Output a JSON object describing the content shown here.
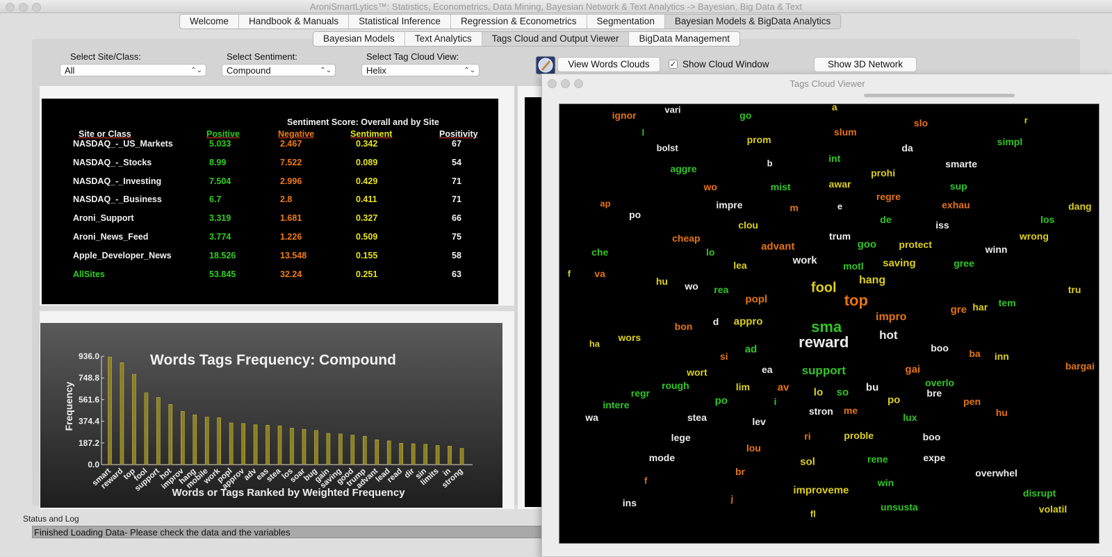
{
  "window": {
    "title": "AroniSmartLytics™: Statistics, Econometrics, Data Mining, Bayesian Network & Text Analytics -> Bayesian, Big Data & Text"
  },
  "main_tabs": [
    "Welcome",
    "Handbook & Manuals",
    "Statistical Inference",
    "Regression & Econometrics",
    "Segmentation",
    "Bayesian Models & BigData Analytics"
  ],
  "sub_tabs": [
    "Bayesian Models",
    "Text Analytics",
    "Tags Cloud and Output Viewer",
    "BigData Management"
  ],
  "controls": {
    "site_label": "Select Site/Class:",
    "site_value": "All",
    "sentiment_label": "Select  Sentiment:",
    "sentiment_value": "Compound",
    "view_label": "Select Tag Cloud View:",
    "view_value": "Helix",
    "view_clouds_button": "View Words Clouds",
    "show_cloud_label": "Show Cloud Window",
    "show_cloud_checked": true,
    "show_3d_button": "Show 3D Network"
  },
  "sentiment_table": {
    "title": "Sentiment Score: Overall and by Site",
    "headers": [
      "Site or Class",
      "Positive",
      "Negative",
      "Sentiment",
      "Positivity"
    ],
    "rows": [
      [
        "NASDAQ_-_US_Markets",
        "5.033",
        "2.467",
        "0.342",
        "67"
      ],
      [
        "NASDAQ_-_Stocks",
        "8.99",
        "7.522",
        "0.089",
        "54"
      ],
      [
        "NASDAQ_-_Investing",
        "7.504",
        "2.996",
        "0.429",
        "71"
      ],
      [
        "NASDAQ_-_Business",
        "6.7",
        "2.8",
        "0.411",
        "71"
      ],
      [
        "Aroni_Support",
        "3.319",
        "1.681",
        "0.327",
        "66"
      ],
      [
        "Aroni_News_Feed",
        "3.774",
        "1.226",
        "0.509",
        "75"
      ],
      [
        "Apple_Developer_News",
        "18.526",
        "13.548",
        "0.155",
        "58"
      ],
      [
        "AllSites",
        "53.845",
        "32.24",
        "0.251",
        "63"
      ]
    ]
  },
  "chart_data": {
    "type": "bar",
    "title": "Words Tags Frequency: Compound",
    "xlabel": "Words or Tags Ranked by Weighted Frequency",
    "ylabel": "Frequency",
    "ylim": [
      0,
      936.0
    ],
    "yticks": [
      "936.0",
      "748.8",
      "561.6",
      "374.4",
      "187.2",
      "0.0"
    ],
    "grid": false,
    "categories": [
      "smart",
      "reward",
      "top",
      "fool",
      "support",
      "hot",
      "improv",
      "hang",
      "mobile",
      "work",
      "popl",
      "approv",
      "adv",
      "eas",
      "stea",
      "los",
      "soar",
      "bug",
      "gain",
      "saving",
      "good",
      "trump",
      "advant",
      "lead",
      "read",
      "dir",
      "sin",
      "limits",
      "in",
      "strong"
    ],
    "values": [
      930,
      880,
      780,
      620,
      580,
      520,
      460,
      430,
      410,
      405,
      360,
      355,
      345,
      340,
      335,
      315,
      305,
      295,
      270,
      265,
      255,
      245,
      215,
      205,
      185,
      180,
      175,
      165,
      160,
      140
    ]
  },
  "cloud": {
    "title": "Tags Cloud Viewer",
    "words": [
      {
        "t": "ignor",
        "c": "o",
        "s": 14,
        "x": 12,
        "y": 2.6
      },
      {
        "t": "vari",
        "c": "w",
        "s": 13,
        "x": 21,
        "y": 1.2
      },
      {
        "t": "go",
        "c": "g",
        "s": 14,
        "x": 34.5,
        "y": 2.6
      },
      {
        "t": "a",
        "c": "y",
        "s": 14,
        "x": 51,
        "y": 0.6
      },
      {
        "t": "r",
        "c": "y",
        "s": 13,
        "x": 86.5,
        "y": 3.6
      },
      {
        "t": "slo",
        "c": "o",
        "s": 14,
        "x": 67,
        "y": 4.2
      },
      {
        "t": "l",
        "c": "g",
        "s": 13,
        "x": 15.5,
        "y": 6.5
      },
      {
        "t": "prom",
        "c": "y",
        "s": 14,
        "x": 37,
        "y": 8
      },
      {
        "t": "slum",
        "c": "o",
        "s": 14,
        "x": 53,
        "y": 6.4
      },
      {
        "t": "simpl",
        "c": "g",
        "s": 14,
        "x": 83.5,
        "y": 8.5
      },
      {
        "t": "bolst",
        "c": "w",
        "s": 13,
        "x": 20,
        "y": 10
      },
      {
        "t": "da",
        "c": "w",
        "s": 14,
        "x": 64.5,
        "y": 10
      },
      {
        "t": "int",
        "c": "g",
        "s": 14,
        "x": 51,
        "y": 12.4
      },
      {
        "t": "b",
        "c": "w",
        "s": 13,
        "x": 39,
        "y": 13.4
      },
      {
        "t": "smarte",
        "c": "w",
        "s": 14,
        "x": 74.5,
        "y": 13.6
      },
      {
        "t": "aggre",
        "c": "g",
        "s": 14,
        "x": 23,
        "y": 14.7
      },
      {
        "t": "prohi",
        "c": "y",
        "s": 14,
        "x": 60,
        "y": 15.7
      },
      {
        "t": "wo",
        "c": "o",
        "s": 14,
        "x": 28,
        "y": 18.8
      },
      {
        "t": "mist",
        "c": "g",
        "s": 14,
        "x": 41,
        "y": 18.8
      },
      {
        "t": "awar",
        "c": "y",
        "s": 14,
        "x": 52,
        "y": 18.2
      },
      {
        "t": "sup",
        "c": "g",
        "s": 14,
        "x": 74,
        "y": 18.6
      },
      {
        "t": "regre",
        "c": "o",
        "s": 14,
        "x": 61,
        "y": 21.1
      },
      {
        "t": "ap",
        "c": "o",
        "s": 13,
        "x": 8.5,
        "y": 22.6
      },
      {
        "t": "impre",
        "c": "w",
        "s": 14,
        "x": 31.5,
        "y": 23
      },
      {
        "t": "m",
        "c": "o",
        "s": 14,
        "x": 43.5,
        "y": 23.6
      },
      {
        "t": "e",
        "c": "w",
        "s": 13,
        "x": 52,
        "y": 23.3
      },
      {
        "t": "exhau",
        "c": "o",
        "s": 14,
        "x": 73.5,
        "y": 22.9
      },
      {
        "t": "dang",
        "c": "y",
        "s": 14,
        "x": 96.5,
        "y": 23.3
      },
      {
        "t": "po",
        "c": "w",
        "s": 14,
        "x": 14,
        "y": 25.1
      },
      {
        "t": "de",
        "c": "g",
        "s": 14,
        "x": 60.5,
        "y": 26.3
      },
      {
        "t": "clou",
        "c": "y",
        "s": 14,
        "x": 35,
        "y": 27.5
      },
      {
        "t": "iss",
        "c": "w",
        "s": 14,
        "x": 71,
        "y": 27.5
      },
      {
        "t": "los",
        "c": "g",
        "s": 14,
        "x": 90.5,
        "y": 26.3
      },
      {
        "t": "cheap",
        "c": "o",
        "s": 14,
        "x": 23.5,
        "y": 30.6
      },
      {
        "t": "trum",
        "c": "w",
        "s": 14,
        "x": 52,
        "y": 30
      },
      {
        "t": "wrong",
        "c": "y",
        "s": 14,
        "x": 88,
        "y": 30
      },
      {
        "t": "advant",
        "c": "o",
        "s": 15,
        "x": 40.5,
        "y": 32.5
      },
      {
        "t": "goo",
        "c": "g",
        "s": 15,
        "x": 57,
        "y": 31.9
      },
      {
        "t": "protect",
        "c": "y",
        "s": 14,
        "x": 66,
        "y": 31.9
      },
      {
        "t": "che",
        "c": "g",
        "s": 14,
        "x": 7.5,
        "y": 33.7
      },
      {
        "t": "lo",
        "c": "g",
        "s": 14,
        "x": 28,
        "y": 33.7
      },
      {
        "t": "winn",
        "c": "w",
        "s": 14,
        "x": 81,
        "y": 33.1
      },
      {
        "t": "work",
        "c": "w",
        "s": 15,
        "x": 45.5,
        "y": 35.6
      },
      {
        "t": "lea",
        "c": "y",
        "s": 14,
        "x": 33.5,
        "y": 36.7
      },
      {
        "t": "motl",
        "c": "g",
        "s": 14,
        "x": 54.5,
        "y": 36.9
      },
      {
        "t": "saving",
        "c": "y",
        "s": 15,
        "x": 63,
        "y": 36.3
      },
      {
        "t": "gree",
        "c": "g",
        "s": 14,
        "x": 75,
        "y": 36.3
      },
      {
        "t": "f",
        "c": "y",
        "s": 13,
        "x": 1.8,
        "y": 38.6
      },
      {
        "t": "va",
        "c": "o",
        "s": 14,
        "x": 7.5,
        "y": 38.6
      },
      {
        "t": "hu",
        "c": "y",
        "s": 14,
        "x": 19,
        "y": 40.4
      },
      {
        "t": "wo",
        "c": "w",
        "s": 14,
        "x": 24.5,
        "y": 41.5
      },
      {
        "t": "fool",
        "c": "y",
        "s": 20,
        "x": 49,
        "y": 41.9
      },
      {
        "t": "hang",
        "c": "y",
        "s": 16,
        "x": 58,
        "y": 40.2
      },
      {
        "t": "tru",
        "c": "y",
        "s": 14,
        "x": 95.5,
        "y": 42.3
      },
      {
        "t": "rea",
        "c": "g",
        "s": 14,
        "x": 30,
        "y": 42.3
      },
      {
        "t": "popl",
        "c": "o",
        "s": 15,
        "x": 36.5,
        "y": 44.5
      },
      {
        "t": "top",
        "c": "o",
        "s": 22,
        "x": 55,
        "y": 44.8
      },
      {
        "t": "tem",
        "c": "g",
        "s": 14,
        "x": 83,
        "y": 45.2
      },
      {
        "t": "gre",
        "c": "o",
        "s": 15,
        "x": 74,
        "y": 46.9
      },
      {
        "t": "har",
        "c": "y",
        "s": 14,
        "x": 78,
        "y": 46.2
      },
      {
        "t": "impro",
        "c": "o",
        "s": 16,
        "x": 61.5,
        "y": 48.5
      },
      {
        "t": "sma",
        "c": "g",
        "s": 22,
        "x": 49.5,
        "y": 50.8
      },
      {
        "t": "bon",
        "c": "o",
        "s": 14,
        "x": 23,
        "y": 50.6
      },
      {
        "t": "d",
        "c": "w",
        "s": 14,
        "x": 29,
        "y": 49.6
      },
      {
        "t": "appro",
        "c": "y",
        "s": 15,
        "x": 35,
        "y": 49.6
      },
      {
        "t": "hot",
        "c": "w",
        "s": 17,
        "x": 61,
        "y": 52.7
      },
      {
        "t": "ha",
        "c": "y",
        "s": 13,
        "x": 6.5,
        "y": 54.6
      },
      {
        "t": "wors",
        "c": "y",
        "s": 14,
        "x": 13,
        "y": 53.2
      },
      {
        "t": "reward",
        "c": "w",
        "s": 22,
        "x": 49,
        "y": 54.3
      },
      {
        "t": "boo",
        "c": "w",
        "s": 14,
        "x": 70.5,
        "y": 55.5
      },
      {
        "t": "ad",
        "c": "g",
        "s": 15,
        "x": 35.5,
        "y": 55.8
      },
      {
        "t": "ba",
        "c": "o",
        "s": 14,
        "x": 77,
        "y": 56.8
      },
      {
        "t": "inn",
        "c": "y",
        "s": 14,
        "x": 82,
        "y": 57.5
      },
      {
        "t": "si",
        "c": "o",
        "s": 14,
        "x": 30.5,
        "y": 57.5
      },
      {
        "t": "bargai",
        "c": "o",
        "s": 14,
        "x": 96.5,
        "y": 59.7
      },
      {
        "t": "wort",
        "c": "y",
        "s": 14,
        "x": 25.5,
        "y": 61
      },
      {
        "t": "ea",
        "c": "w",
        "s": 14,
        "x": 38.5,
        "y": 60.4
      },
      {
        "t": "support",
        "c": "g",
        "s": 17,
        "x": 49,
        "y": 60.8
      },
      {
        "t": "gai",
        "c": "o",
        "s": 15,
        "x": 65.5,
        "y": 60.4
      },
      {
        "t": "rough",
        "c": "g",
        "s": 14,
        "x": 21.5,
        "y": 64.1
      },
      {
        "t": "lim",
        "c": "y",
        "s": 14,
        "x": 34,
        "y": 64.4
      },
      {
        "t": "av",
        "c": "o",
        "s": 15,
        "x": 41.5,
        "y": 64.6
      },
      {
        "t": "bu",
        "c": "w",
        "s": 15,
        "x": 58,
        "y": 64.6
      },
      {
        "t": "overlo",
        "c": "g",
        "s": 14,
        "x": 70.5,
        "y": 63.4
      },
      {
        "t": "regr",
        "c": "g",
        "s": 14,
        "x": 15,
        "y": 65.8
      },
      {
        "t": "lo",
        "c": "y",
        "s": 15,
        "x": 48,
        "y": 65.7
      },
      {
        "t": "so",
        "c": "g",
        "s": 15,
        "x": 52.5,
        "y": 65.7
      },
      {
        "t": "bre",
        "c": "w",
        "s": 14,
        "x": 69.5,
        "y": 65.8
      },
      {
        "t": "po",
        "c": "g",
        "s": 15,
        "x": 30,
        "y": 67.6
      },
      {
        "t": "i",
        "c": "g",
        "s": 14,
        "x": 40,
        "y": 67.8
      },
      {
        "t": "po",
        "c": "y",
        "s": 15,
        "x": 62,
        "y": 67.4
      },
      {
        "t": "pen",
        "c": "o",
        "s": 14,
        "x": 76.5,
        "y": 67.8
      },
      {
        "t": "intere",
        "c": "g",
        "s": 14,
        "x": 10.5,
        "y": 68.5
      },
      {
        "t": "stron",
        "c": "w",
        "s": 14,
        "x": 48.5,
        "y": 70
      },
      {
        "t": "me",
        "c": "o",
        "s": 14,
        "x": 54,
        "y": 69.8
      },
      {
        "t": "hu",
        "c": "o",
        "s": 14,
        "x": 82,
        "y": 70.3
      },
      {
        "t": "wa",
        "c": "w",
        "s": 14,
        "x": 6,
        "y": 71.4
      },
      {
        "t": "stea",
        "c": "w",
        "s": 14,
        "x": 25.5,
        "y": 71.4
      },
      {
        "t": "lev",
        "c": "w",
        "s": 14,
        "x": 37,
        "y": 72.3
      },
      {
        "t": "lux",
        "c": "g",
        "s": 14,
        "x": 65,
        "y": 71.4
      },
      {
        "t": "lege",
        "c": "w",
        "s": 14,
        "x": 22.5,
        "y": 76
      },
      {
        "t": "ri",
        "c": "o",
        "s": 14,
        "x": 46,
        "y": 75.6
      },
      {
        "t": "proble",
        "c": "y",
        "s": 14,
        "x": 55.5,
        "y": 75.5
      },
      {
        "t": "boo",
        "c": "w",
        "s": 14,
        "x": 69,
        "y": 75.8
      },
      {
        "t": "lou",
        "c": "o",
        "s": 14,
        "x": 36,
        "y": 78.3
      },
      {
        "t": "mode",
        "c": "w",
        "s": 14,
        "x": 19,
        "y": 80.5
      },
      {
        "t": "sol",
        "c": "y",
        "s": 15,
        "x": 46,
        "y": 81.5
      },
      {
        "t": "rene",
        "c": "g",
        "s": 14,
        "x": 59,
        "y": 80.8
      },
      {
        "t": "expe",
        "c": "w",
        "s": 14,
        "x": 69.5,
        "y": 80.5
      },
      {
        "t": "br",
        "c": "o",
        "s": 14,
        "x": 33.5,
        "y": 83.7
      },
      {
        "t": "overwhel",
        "c": "w",
        "s": 14,
        "x": 81,
        "y": 84
      },
      {
        "t": "f",
        "c": "o",
        "s": 13,
        "x": 16,
        "y": 85.8
      },
      {
        "t": "win",
        "c": "g",
        "s": 14,
        "x": 60.5,
        "y": 86.3
      },
      {
        "t": "improveme",
        "c": "y",
        "s": 15,
        "x": 48.5,
        "y": 87.9
      },
      {
        "t": "disrupt",
        "c": "g",
        "s": 14,
        "x": 89,
        "y": 88.6
      },
      {
        "t": "j",
        "c": "o",
        "s": 13,
        "x": 32,
        "y": 89.8
      },
      {
        "t": "ins",
        "c": "w",
        "s": 14,
        "x": 13,
        "y": 90.8
      },
      {
        "t": "unsusta",
        "c": "g",
        "s": 14,
        "x": 63,
        "y": 91.7
      },
      {
        "t": "volatil",
        "c": "y",
        "s": 14,
        "x": 91.5,
        "y": 92.2
      },
      {
        "t": "fl",
        "c": "y",
        "s": 13,
        "x": 47,
        "y": 93.3
      }
    ]
  },
  "status": {
    "label": "Status and Log",
    "message": "Finished Loading Data- Please check the data and the variables"
  },
  "colors": {
    "positive": "#2fcf1f",
    "negative": "#f07c12",
    "sentiment": "#e9e51a",
    "bars": "#8a7f22"
  }
}
